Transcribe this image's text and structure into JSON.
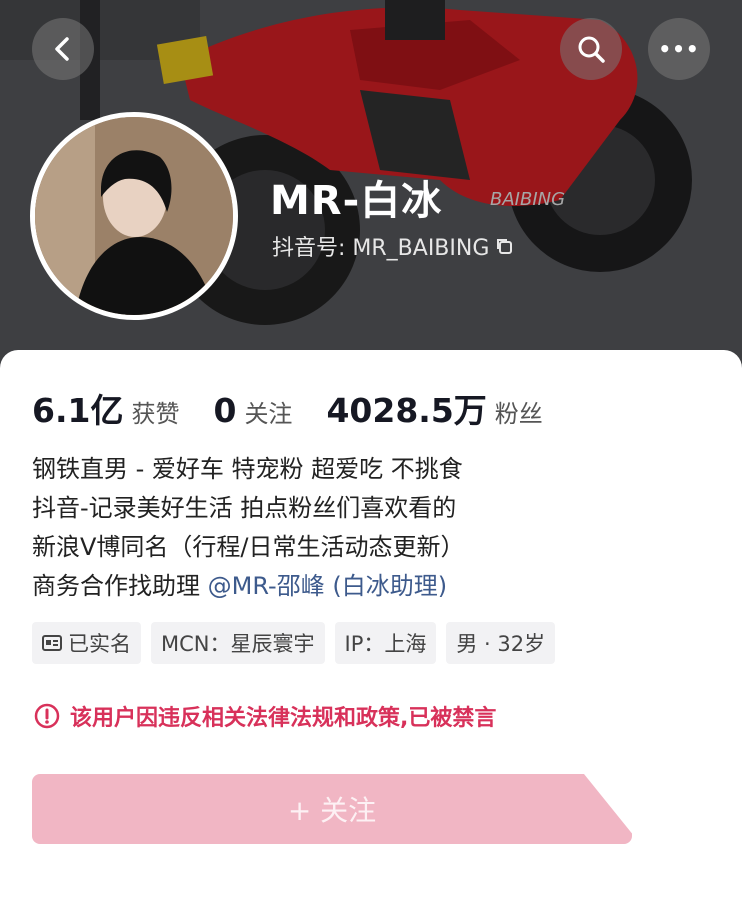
{
  "header": {
    "back_icon": "back-icon",
    "search_icon": "search-icon",
    "more_icon": "more-icon",
    "more_label": "•••",
    "bike_logo": "BAIBING"
  },
  "profile": {
    "name": "MR-白冰",
    "douyin_id": "抖音号: MR_BAIBING",
    "copy_icon": "copy-icon"
  },
  "stats": [
    {
      "value": "6.1亿",
      "label": "获赞"
    },
    {
      "value": "0",
      "label": "关注"
    },
    {
      "value": "4028.5万",
      "label": "粉丝"
    }
  ],
  "bio": {
    "line1": "钢铁直男 - 爱好车 特宠粉 超爱吃 不挑食",
    "line2": "抖音-记录美好生活 拍点粉丝们喜欢看的",
    "line3": "新浪V博同名（行程/日常生活动态更新）",
    "line4_prefix": "商务合作找助理 ",
    "line4_mention": "@MR-邵峰 (白冰助理)"
  },
  "tags": {
    "verified": "已实名",
    "verified_icon": "id-card-icon",
    "mcn": "MCN：星辰寰宇",
    "ip": "IP：上海",
    "gender_age": "男 · 32岁"
  },
  "notice": {
    "icon": "warning-icon",
    "text": "该用户因违反相关法律法规和政策,已被禁言",
    "color": "#d8315a"
  },
  "follow_button": {
    "label": "+ 关注",
    "color": "#f1b6c4"
  }
}
